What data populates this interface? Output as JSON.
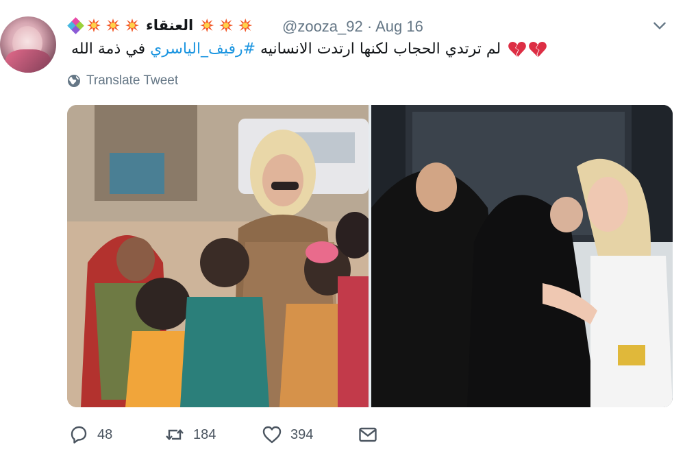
{
  "colors": {
    "link": "#1b95e0",
    "secondary_text": "#657786",
    "primary_text": "#14171a",
    "action_text": "#4b5560",
    "broken_heart": "#dd2e44",
    "burst": "#f25a2a"
  },
  "tweet": {
    "author": {
      "display_name": "العنقاء",
      "handle": "@zooza_92",
      "separator": "·",
      "date": "Aug 16",
      "avatar_icon": "avatar",
      "name_decorations": [
        "diamond-icon",
        "burst-icon",
        "burst-icon",
        "burst-icon",
        "burst-icon",
        "burst-icon",
        "burst-icon"
      ]
    },
    "more_icon": "chevron-down-icon",
    "text": {
      "before_hashtag": "لم ترتدي الحجاب لكنها ارتدت الانسانيه ",
      "hashtag": "#رفيف_الياسري",
      "after_hashtag": " في ذمة الله",
      "emoji": [
        "broken-heart-icon",
        "broken-heart-icon"
      ]
    },
    "translate_label": "Translate Tweet",
    "media": [
      {
        "name": "photo-woman-with-children"
      },
      {
        "name": "photo-women-embracing"
      }
    ],
    "actions": {
      "reply_count": "48",
      "retweet_count": "184",
      "like_count": "394",
      "dm_icon": "envelope-icon"
    }
  }
}
